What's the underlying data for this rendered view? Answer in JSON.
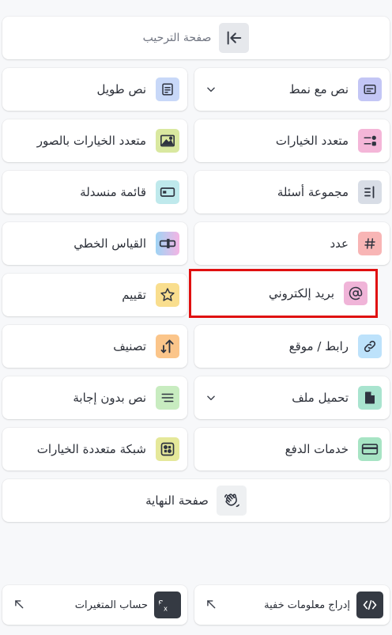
{
  "welcome": {
    "label": "صفحة الترحيب",
    "icon": "collapse-left-icon"
  },
  "items": [
    {
      "label": "نص مع نمط",
      "icon": "styled-text-icon",
      "color": "#c3c6f5",
      "has_chevron": true
    },
    {
      "label": "نص طويل",
      "icon": "long-text-icon",
      "color": "#c8d8f8"
    },
    {
      "label": "متعدد الخيارات",
      "icon": "multiple-choice-icon",
      "color": "#f4b6d8"
    },
    {
      "label": "متعدد الخيارات بالصور",
      "icon": "image-choice-icon",
      "color": "#d9e8a0"
    },
    {
      "label": "مجموعة أسئلة",
      "icon": "question-group-icon",
      "color": "#d8dde6"
    },
    {
      "label": "قائمة منسدلة",
      "icon": "dropdown-icon",
      "color": "#bfe9ec"
    },
    {
      "label": "عدد",
      "icon": "hash-icon",
      "color": "#f8b5b5"
    },
    {
      "label": "القياس الخطي",
      "icon": "linear-scale-icon",
      "color": "#e4c4f4"
    },
    {
      "label": "بريد إلكتروني",
      "icon": "at-icon",
      "color": "#f0b4d8",
      "selected": true
    },
    {
      "label": "تقييم",
      "icon": "star-icon",
      "color": "#f9de8e"
    },
    {
      "label": "رابط / موقع",
      "icon": "link-icon",
      "color": "#bde2fb"
    },
    {
      "label": "تصنيف",
      "icon": "ranking-icon",
      "color": "#fbc58a"
    },
    {
      "label": "تحميل ملف",
      "icon": "file-icon",
      "color": "#a9e4cf",
      "has_chevron": true
    },
    {
      "label": "نص بدون إجابة",
      "icon": "statement-icon",
      "color": "#c8ecc0"
    },
    {
      "label": "خدمات الدفع",
      "icon": "credit-card-icon",
      "color": "#a7e4c4"
    },
    {
      "label": "شبكة متعددة الخيارات",
      "icon": "grid-icon",
      "color": "#e5e89a"
    }
  ],
  "ending": {
    "label": "صفحة النهاية",
    "icon": "waving-hand-icon"
  },
  "bottom": [
    {
      "label": "إدراج معلومات خفية",
      "icon": "code-icon",
      "color": "#353a43"
    },
    {
      "label": "حساب المتغيرات",
      "icon": "function-icon",
      "color": "#353a43"
    }
  ]
}
